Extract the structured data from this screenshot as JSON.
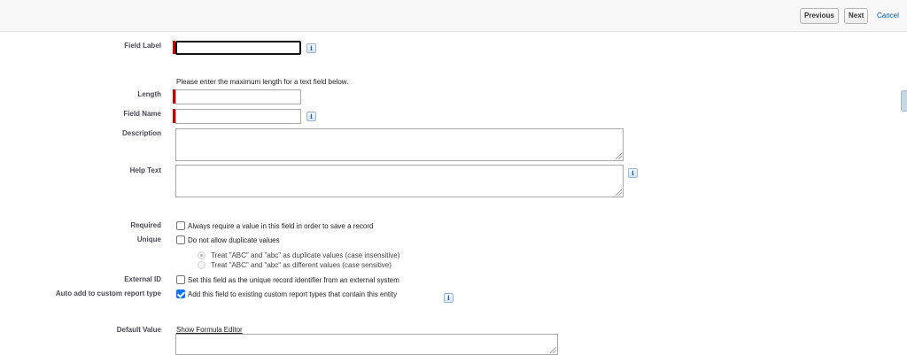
{
  "toolbar": {
    "previous_label": "Previous",
    "next_label": "Next",
    "cancel_label": "Cancel"
  },
  "form": {
    "field_label": {
      "label": "Field Label",
      "value": ""
    },
    "length_hint": "Please enter the maximum length for a text field below.",
    "length": {
      "label": "Length",
      "value": ""
    },
    "field_name": {
      "label": "Field Name",
      "value": ""
    },
    "description": {
      "label": "Description",
      "value": ""
    },
    "help_text": {
      "label": "Help Text",
      "value": ""
    },
    "required": {
      "label": "Required",
      "text": "Always require a value in this field in order to save a record",
      "checked": false
    },
    "unique": {
      "label": "Unique",
      "text": "Do not allow duplicate values",
      "checked": false,
      "options": [
        "Treat \"ABC\" and \"abc\" as duplicate values (case insensitive)",
        "Treat \"ABC\" and \"abc\" as different values (case sensitive)"
      ]
    },
    "external_id": {
      "label": "External ID",
      "text": "Set this field as the unique record identifier from an external system",
      "checked": false
    },
    "auto_add": {
      "label": "Auto add to custom report type",
      "text": "Add this field to existing custom report types that contain this entity",
      "checked": true
    },
    "default_value": {
      "label": "Default Value",
      "link": "Show Formula Editor"
    }
  },
  "icons": {
    "info": "i",
    "info_icon_name": "info-icon",
    "resize_grip": "resize-grip-icon"
  },
  "colors": {
    "required_marker": "#cc0000",
    "link": "#015ba7",
    "checkbox_checked": "#0075ff"
  }
}
